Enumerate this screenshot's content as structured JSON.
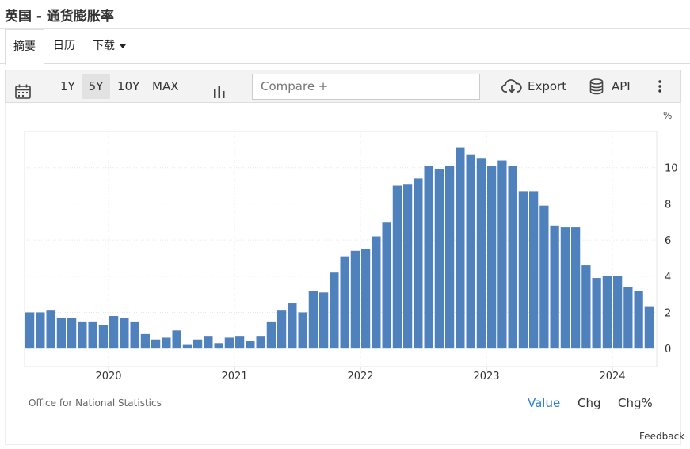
{
  "page": {
    "title": "英国 - 通货膨胀率"
  },
  "tabs": [
    {
      "label": "摘要"
    },
    {
      "label": "日历"
    },
    {
      "label": "下载"
    }
  ],
  "toolbar": {
    "ranges": [
      "1Y",
      "5Y",
      "10Y",
      "MAX"
    ],
    "selected_range": "5Y",
    "compare_placeholder": "Compare +",
    "export_label": "Export",
    "api_label": "API"
  },
  "footer": {
    "source": "Office for National Statistics",
    "modes": [
      "Value",
      "Chg",
      "Chg%"
    ],
    "active_mode": "Value",
    "feedback": "Feedback"
  },
  "colors": {
    "bar": "#4f81bd",
    "active_mode": "#2f7ed8"
  },
  "chart_data": {
    "type": "bar",
    "unit_label": "%",
    "y_ticks": [
      0,
      2,
      4,
      6,
      8,
      10
    ],
    "ylim": [
      -1,
      12
    ],
    "x_ticks": [
      "2020",
      "2021",
      "2022",
      "2023",
      "2024"
    ],
    "x_tick_index": [
      7,
      19,
      31,
      43,
      55
    ],
    "grid": true,
    "categories": [
      "2019-05",
      "2019-06",
      "2019-07",
      "2019-08",
      "2019-09",
      "2019-10",
      "2019-11",
      "2019-12",
      "2020-01",
      "2020-02",
      "2020-03",
      "2020-04",
      "2020-05",
      "2020-06",
      "2020-07",
      "2020-08",
      "2020-09",
      "2020-10",
      "2020-11",
      "2020-12",
      "2021-01",
      "2021-02",
      "2021-03",
      "2021-04",
      "2021-05",
      "2021-06",
      "2021-07",
      "2021-08",
      "2021-09",
      "2021-10",
      "2021-11",
      "2021-12",
      "2022-01",
      "2022-02",
      "2022-03",
      "2022-04",
      "2022-05",
      "2022-06",
      "2022-07",
      "2022-08",
      "2022-09",
      "2022-10",
      "2022-11",
      "2022-12",
      "2023-01",
      "2023-02",
      "2023-03",
      "2023-04",
      "2023-05",
      "2023-06",
      "2023-07",
      "2023-08",
      "2023-09",
      "2023-10",
      "2023-11",
      "2023-12",
      "2024-01",
      "2024-02",
      "2024-03",
      "2024-04"
    ],
    "values": [
      2.0,
      2.0,
      2.1,
      1.7,
      1.7,
      1.5,
      1.5,
      1.3,
      1.8,
      1.7,
      1.5,
      0.8,
      0.5,
      0.6,
      1.0,
      0.2,
      0.5,
      0.7,
      0.3,
      0.6,
      0.7,
      0.4,
      0.7,
      1.5,
      2.1,
      2.5,
      2.0,
      3.2,
      3.1,
      4.2,
      5.1,
      5.4,
      5.5,
      6.2,
      7.0,
      9.0,
      9.1,
      9.4,
      10.1,
      9.9,
      10.1,
      11.1,
      10.7,
      10.5,
      10.1,
      10.4,
      10.1,
      8.7,
      8.7,
      7.9,
      6.8,
      6.7,
      6.7,
      4.6,
      3.9,
      4.0,
      4.0,
      3.4,
      3.2,
      2.3
    ]
  }
}
